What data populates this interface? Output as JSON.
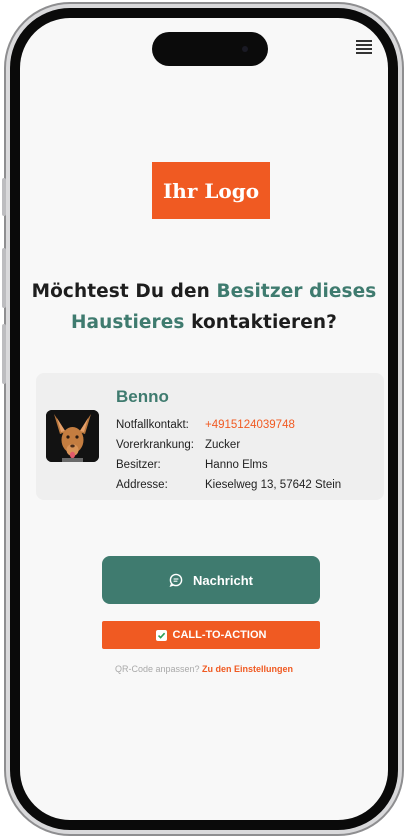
{
  "logo": {
    "text": "Ihr Logo"
  },
  "headline": {
    "part1": "Möchtest Du den ",
    "highlight1": "Besitzer dieses",
    "highlight2": "Haustieres",
    "part2": " kontaktieren?"
  },
  "pet": {
    "name": "Benno",
    "fields": [
      {
        "label": "Notfallkontakt:",
        "value": "+4915124039748"
      },
      {
        "label": "Vorerkrankung:",
        "value": "Zucker"
      },
      {
        "label": "Besitzer:",
        "value": "Hanno Elms"
      },
      {
        "label": "Addresse:",
        "value": "Kieselweg 13, 57642 Stein"
      }
    ]
  },
  "buttons": {
    "message_label": "Nachricht",
    "cta_label": "CALL-TO-ACTION"
  },
  "footer": {
    "prompt": "QR-Code anpassen? ",
    "link": "Zu den Einstellungen"
  },
  "colors": {
    "accent_orange": "#f05a22",
    "accent_green": "#3f7b6f"
  },
  "icons": [
    "menu-icon",
    "chat-bubble-icon",
    "checkbox-icon"
  ]
}
